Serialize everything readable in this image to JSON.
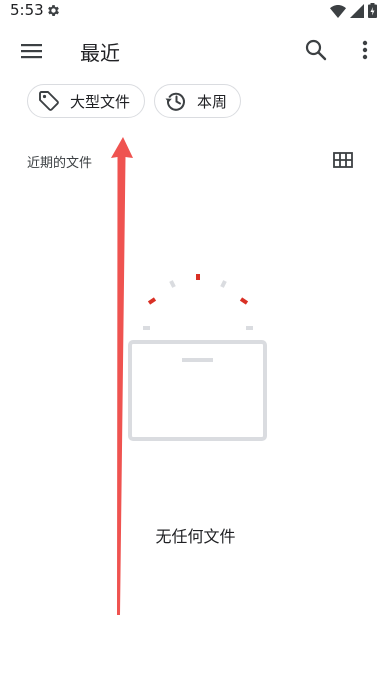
{
  "status_bar": {
    "time": "5:53"
  },
  "app_bar": {
    "title": "最近"
  },
  "filters": {
    "large_files_label": "大型文件",
    "this_week_label": "本周"
  },
  "section": {
    "label": "近期的文件"
  },
  "empty_state": {
    "message": "无任何文件"
  },
  "colors": {
    "accent_red": "#d93025",
    "overlay_arrow": "#ef5350",
    "chip_border": "#dadce0",
    "illustration_gray": "#dadce0"
  },
  "icons": {
    "menu": "menu-icon",
    "search": "search-icon",
    "more": "more-vert-icon",
    "large_files": "tag-icon",
    "this_week": "history-icon",
    "grid": "grid-view-icon"
  }
}
